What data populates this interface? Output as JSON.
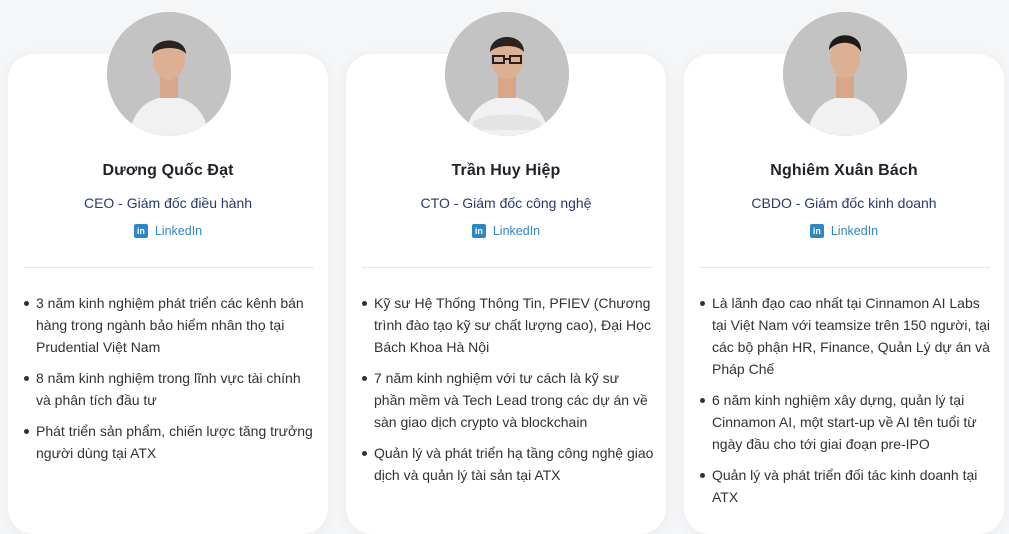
{
  "linkedin_label": "LinkedIn",
  "linkedin_icon": "linkedin-icon",
  "accent_color": "#2f86c7",
  "role_color": "#283a6b",
  "members": [
    {
      "name": "Dương Quốc Đạt",
      "role": "CEO - Giám đốc điều hành",
      "bullets": [
        "3 năm kinh nghiệm phát triển các kênh bán hàng trong ngành bảo hiểm nhân thọ tại Prudential Việt Nam",
        "8 năm kinh nghiệm trong lĩnh vực tài chính và phân tích đầu tư",
        "Phát triển sản phẩm, chiến lược tăng trưởng người dùng tại ATX"
      ]
    },
    {
      "name": "Trần Huy Hiệp",
      "role": "CTO - Giám đốc công nghệ",
      "bullets": [
        "Kỹ sư Hệ Thống Thông Tin, PFIEV (Chương trình đào tạo kỹ sư chất lượng cao), Đại Học Bách Khoa Hà Nội",
        "7 năm kinh nghiệm với tư cách là kỹ sư phần mềm và Tech Lead trong các dự án về sàn giao dịch crypto và blockchain",
        "Quản lý và phát triển hạ tầng công nghệ giao dịch và quản lý tài sản tại ATX"
      ]
    },
    {
      "name": "Nghiêm Xuân Bách",
      "role": "CBDO - Giám đốc kinh doanh",
      "bullets": [
        "Là lãnh đạo cao nhất tại Cinnamon AI Labs tại Việt Nam với teamsize trên 150 người, tại các bộ phận HR, Finance, Quản Lý dự án và Pháp Chế",
        "6 năm kinh nghiệm xây dựng, quản lý tại Cinnamon AI, một start-up về AI tên tuổi từ ngày đầu cho tới giai đoạn pre-IPO",
        "Quản lý và phát triển đối tác kinh doanh tại ATX"
      ]
    }
  ]
}
